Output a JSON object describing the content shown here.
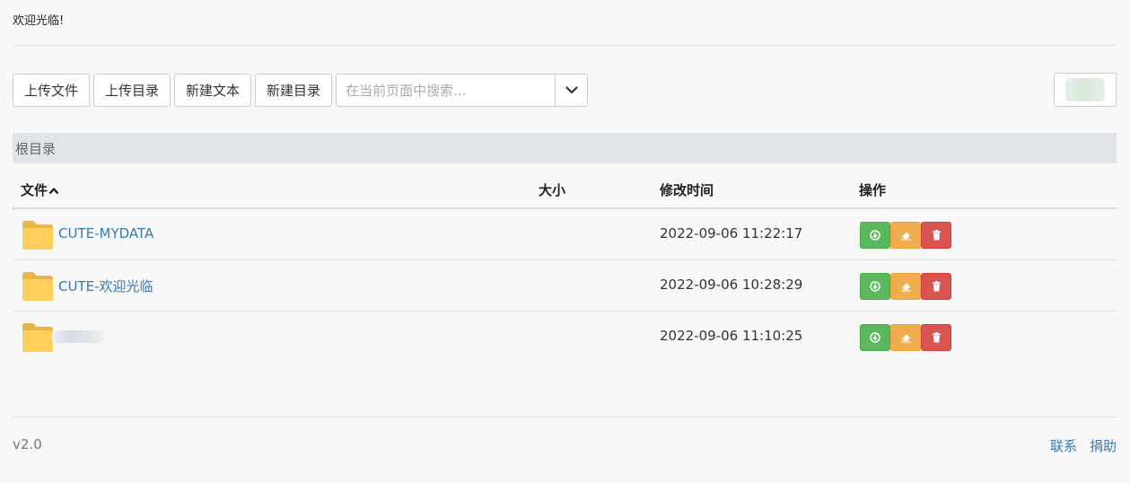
{
  "header": {
    "welcome": "欢迎光临!"
  },
  "toolbar": {
    "upload_file": "上传文件",
    "upload_dir": "上传目录",
    "new_text": "新建文本",
    "new_dir": "新建目录",
    "search_placeholder": "在当前页面中搜索..."
  },
  "breadcrumb": "根目录",
  "table": {
    "columns": [
      "文件",
      "大小",
      "修改时间",
      "操作"
    ],
    "rows": [
      {
        "name": "CUTE-MYDATA",
        "size": "",
        "mtime": "2022-09-06 11:22:17"
      },
      {
        "name": "CUTE-欢迎光临",
        "size": "",
        "mtime": "2022-09-06 10:28:29"
      },
      {
        "name": "",
        "size": "",
        "mtime": "2022-09-06 11:10:25"
      }
    ]
  },
  "footer": {
    "version": "v2.0",
    "links": [
      "联系",
      "捐助"
    ]
  },
  "icons": {
    "folder": "folder-icon",
    "sort": "chevron-up-icon",
    "dropdown": "chevron-down-icon",
    "download": "download-icon",
    "rename": "eraser-icon",
    "delete": "trash-icon"
  },
  "colors": {
    "link": "#337ab7",
    "download": "#5cb85c",
    "rename": "#f0ad4e",
    "delete": "#d9534f",
    "folder": "#ffce5b"
  }
}
